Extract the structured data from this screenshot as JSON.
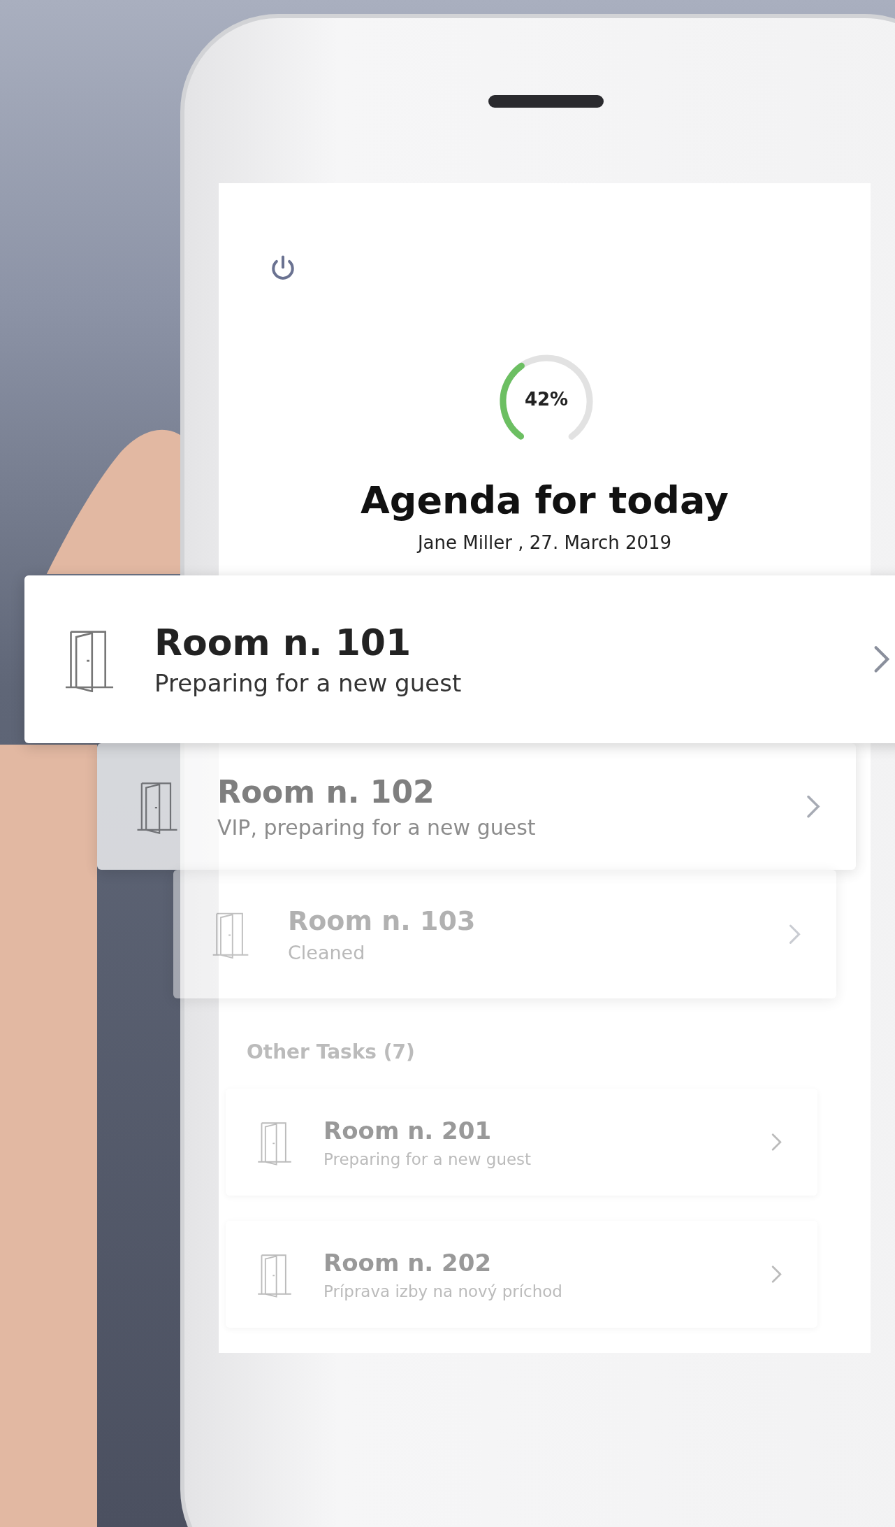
{
  "header": {
    "progress": {
      "level": 0.42,
      "reading": "42%"
    },
    "title": "Agenda for today",
    "subtitle": "Jane Miller , 27. March 2019"
  },
  "tasks": [
    {
      "title": "Room n. 101",
      "subtitle": "Preparing for a new guest",
      "selected": true
    },
    {
      "title": "Room n. 102",
      "subtitle": "VIP, preparing for a new guest",
      "selected": false
    },
    {
      "title": "Room n. 103",
      "subtitle": "Cleaned",
      "selected": false
    }
  ],
  "other_tasks": {
    "heading": "Other Tasks (7)",
    "items": [
      {
        "title": "Room n. 201",
        "subtitle": "Preparing for a new guest"
      },
      {
        "title": "Room n. 202",
        "subtitle": "Príprava izby na nový príchod"
      }
    ]
  }
}
